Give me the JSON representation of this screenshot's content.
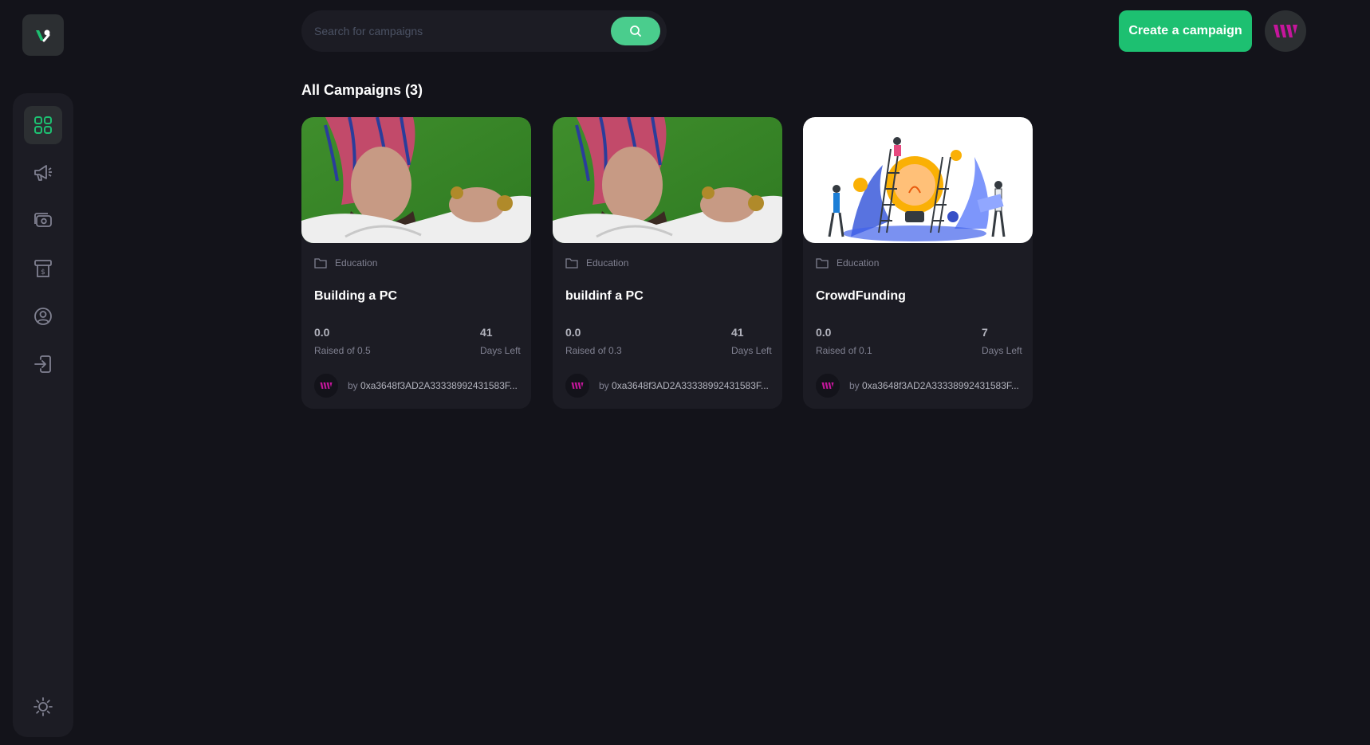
{
  "search": {
    "placeholder": "Search for campaigns",
    "button_icon": "search-icon"
  },
  "header": {
    "create_label": "Create a campaign",
    "profile_icon": "w-logo-icon"
  },
  "sidebar": {
    "logo_icon": "brand-logo-icon",
    "items": [
      {
        "icon": "dashboard-icon",
        "active": true
      },
      {
        "icon": "megaphone-icon"
      },
      {
        "icon": "payment-icon"
      },
      {
        "icon": "withdraw-icon"
      },
      {
        "icon": "profile-icon"
      },
      {
        "icon": "logout-icon"
      }
    ],
    "theme_icon": "sun-icon"
  },
  "main": {
    "title": "All Campaigns (3)",
    "campaigns": [
      {
        "image_icon": "campaign-photo",
        "category": "Education",
        "title": "Building a PC",
        "raised": "0.0",
        "raised_label": "Raised of 0.5",
        "days": "41",
        "days_label": "Days Left",
        "by": "by",
        "owner": "0xa3648f3AD2A33338992431583F..."
      },
      {
        "image_icon": "campaign-photo",
        "category": "Education",
        "title": "buildinf a PC",
        "raised": "0.0",
        "raised_label": "Raised of 0.3",
        "days": "41",
        "days_label": "Days Left",
        "by": "by",
        "owner": "0xa3648f3AD2A33338992431583F..."
      },
      {
        "image_icon": "crowdfunding-illustration",
        "category": "Education",
        "title": "CrowdFunding",
        "raised": "0.0",
        "raised_label": "Raised of 0.1",
        "days": "7",
        "days_label": "Days Left",
        "by": "by",
        "owner": "0xa3648f3AD2A33338992431583F..."
      }
    ]
  },
  "colors": {
    "accent": "#1dc071",
    "search_btn": "#4acd8d",
    "bg": "#13131a",
    "panel": "#1c1c24"
  }
}
